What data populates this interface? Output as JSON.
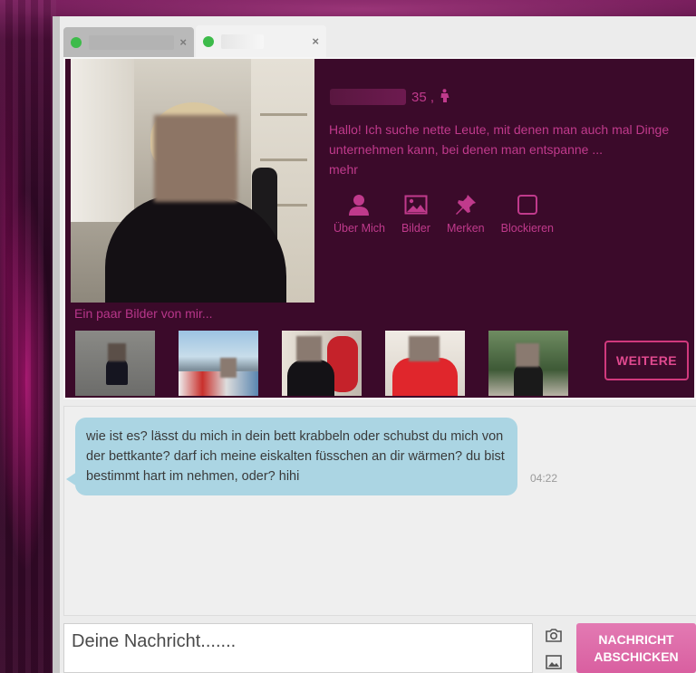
{
  "tabs": [
    {
      "status_color": "#3dbb4a",
      "close_label": "×"
    },
    {
      "status_color": "#3dbb4a",
      "close_label": "×"
    }
  ],
  "profile": {
    "age": "35 ,",
    "gender_icon": "female-icon",
    "bio": "Hallo! Ich suche nette Leute, mit denen man auch mal Dinge unternehmen kann, bei denen man entspanne ...",
    "more_link": "mehr",
    "actions": [
      {
        "label": "Über Mich",
        "icon": "person-icon"
      },
      {
        "label": "Bilder",
        "icon": "image-icon"
      },
      {
        "label": "Merken",
        "icon": "pin-icon"
      },
      {
        "label": "Blockieren",
        "icon": "block-icon"
      }
    ],
    "gallery_label": "Ein paar Bilder von mir...",
    "more_button": "WEITERE",
    "accent_color": "#c03a8c",
    "panel_color": "#3b0a2a"
  },
  "chat": {
    "messages": [
      {
        "text": "wie ist es? lässt du mich in dein bett krabbeln oder schubst du mich von der bettkante? darf ich meine eiskalten füsschen an dir wärmen? du bist bestimmt hart im nehmen, oder? hihi",
        "time": "04:22"
      }
    ],
    "bubble_color": "#abd5e3"
  },
  "composer": {
    "placeholder": "Deine Nachricht.......",
    "camera_icon": "camera-icon",
    "image_icon": "image-icon",
    "send_line_1": "NACHRICHT",
    "send_line_2": "ABSCHICKEN"
  }
}
